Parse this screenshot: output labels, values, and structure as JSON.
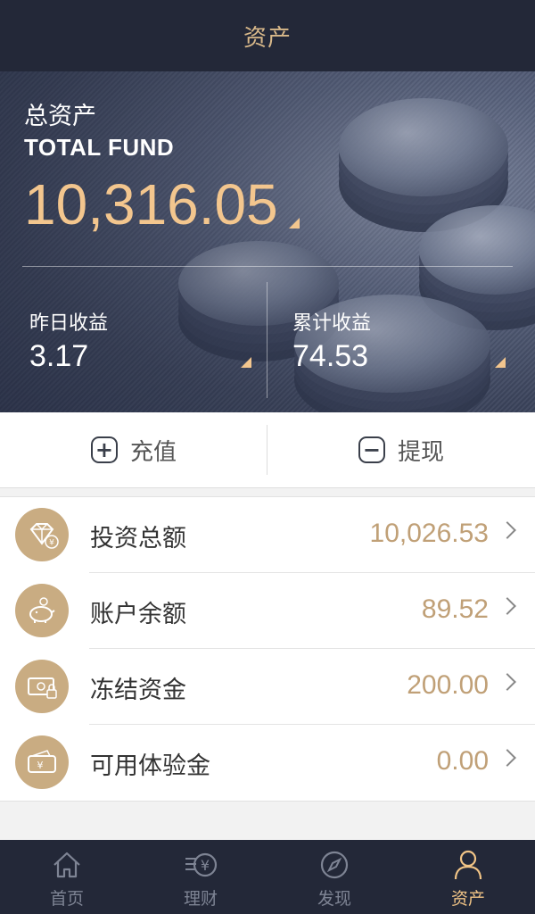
{
  "header": {
    "title": "资产"
  },
  "summary": {
    "total_label": "总资产",
    "total_label_en": "TOTAL FUND",
    "total_value": "10,316.05",
    "yesterday_label": "昨日收益",
    "yesterday_value": "3.17",
    "cumulative_label": "累计收益",
    "cumulative_value": "74.53"
  },
  "actions": {
    "recharge_label": "充值",
    "withdraw_label": "提现"
  },
  "accounts": [
    {
      "label": "投资总额",
      "value": "10,026.53",
      "icon": "diamond-yen-icon"
    },
    {
      "label": "账户余额",
      "value": "89.52",
      "icon": "piggy-bank-icon"
    },
    {
      "label": "冻结资金",
      "value": "200.00",
      "icon": "locked-cash-icon"
    },
    {
      "label": "可用体验金",
      "value": "0.00",
      "icon": "wallet-yen-icon"
    }
  ],
  "tabs": [
    {
      "label": "首页",
      "icon": "home-icon",
      "active": false
    },
    {
      "label": "理财",
      "icon": "finance-icon",
      "active": false
    },
    {
      "label": "发现",
      "icon": "compass-icon",
      "active": false
    },
    {
      "label": "资产",
      "icon": "user-icon",
      "active": true
    }
  ],
  "colors": {
    "header_bg": "#232838",
    "accent_gold": "#f3c68e",
    "icon_bg": "#c9ac82",
    "value_gold": "#c0a077",
    "tab_inactive": "#7e8494"
  }
}
